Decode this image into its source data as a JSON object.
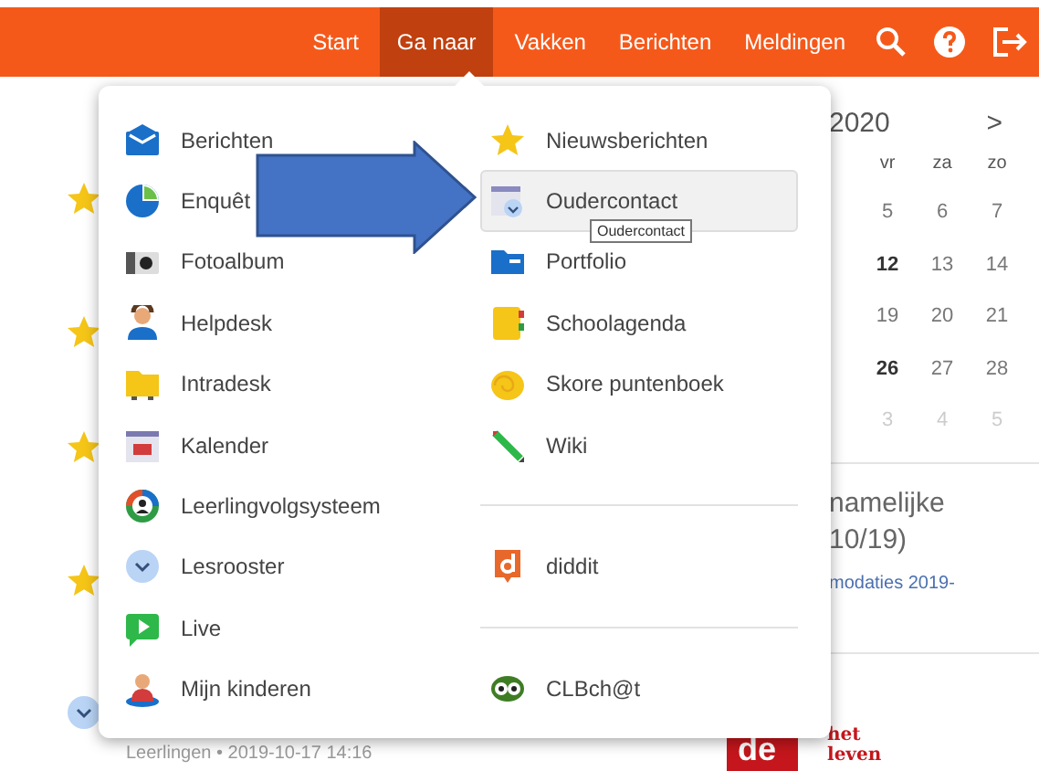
{
  "nav": {
    "items": [
      {
        "label": "Start",
        "selected": false
      },
      {
        "label": "Ga naar",
        "selected": true
      },
      {
        "label": "Vakken",
        "selected": false
      },
      {
        "label": "Berichten",
        "selected": false
      },
      {
        "label": "Meldingen",
        "selected": false
      }
    ]
  },
  "feed": {
    "items": [
      {
        "starred": true
      },
      {
        "starred": true
      },
      {
        "starred": true
      },
      {
        "starred": true
      }
    ],
    "meta": "Leerlingen • 2019-10-17 14:16"
  },
  "calendar": {
    "title": "2020",
    "next": ">",
    "headers": [
      "vr",
      "za",
      "zo"
    ],
    "weeks": [
      [
        {
          "day": "5",
          "bold": false,
          "muted": false
        },
        {
          "day": "6",
          "bold": false,
          "muted": false
        },
        {
          "day": "7",
          "bold": false,
          "muted": false
        }
      ],
      [
        {
          "day": "12",
          "bold": true,
          "muted": false
        },
        {
          "day": "13",
          "bold": false,
          "muted": false
        },
        {
          "day": "14",
          "bold": false,
          "muted": false
        }
      ],
      [
        {
          "day": "19",
          "bold": false,
          "muted": false
        },
        {
          "day": "20",
          "bold": false,
          "muted": false
        },
        {
          "day": "21",
          "bold": false,
          "muted": false
        }
      ],
      [
        {
          "day": "26",
          "bold": true,
          "muted": false
        },
        {
          "day": "27",
          "bold": false,
          "muted": false
        },
        {
          "day": "28",
          "bold": false,
          "muted": false
        }
      ],
      [
        {
          "day": "3",
          "bold": false,
          "muted": true
        },
        {
          "day": "4",
          "bold": false,
          "muted": true
        },
        {
          "day": "5",
          "bold": false,
          "muted": true
        }
      ]
    ]
  },
  "news": {
    "title_lines": [
      "namelijke",
      "10/19)"
    ],
    "link": "modaties 2019-"
  },
  "logo": {
    "mark": "de",
    "words": [
      "het",
      "leven"
    ]
  },
  "menu": {
    "left": [
      {
        "label": "Berichten",
        "highlighted": false
      },
      {
        "label": "Enquêt",
        "highlighted": false
      },
      {
        "label": "Fotoalbum",
        "highlighted": false
      },
      {
        "label": "Helpdesk",
        "highlighted": false
      },
      {
        "label": "Intradesk",
        "highlighted": false
      },
      {
        "label": "Kalender",
        "highlighted": false
      },
      {
        "label": "Leerlingvolgsysteem",
        "highlighted": false
      },
      {
        "label": "Lesrooster",
        "highlighted": false
      },
      {
        "label": "Live",
        "highlighted": false
      },
      {
        "label": "Mijn kinderen",
        "highlighted": false
      }
    ],
    "right": [
      {
        "kind": "link",
        "label": "Nieuwsberichten",
        "highlighted": false
      },
      {
        "kind": "link",
        "label": "Oudercontact",
        "highlighted": true
      },
      {
        "kind": "link",
        "label": "Portfolio",
        "highlighted": false
      },
      {
        "kind": "link",
        "label": "Schoolagenda",
        "highlighted": false
      },
      {
        "kind": "link",
        "label": "Skore puntenboek",
        "highlighted": false
      },
      {
        "kind": "link",
        "label": "Wiki",
        "highlighted": false
      },
      {
        "kind": "divider"
      },
      {
        "kind": "link",
        "label": "diddit",
        "highlighted": false
      },
      {
        "kind": "divider"
      },
      {
        "kind": "link",
        "label": "CLBch@t",
        "highlighted": false
      }
    ]
  },
  "tooltip": {
    "text": "Oudercontact"
  }
}
